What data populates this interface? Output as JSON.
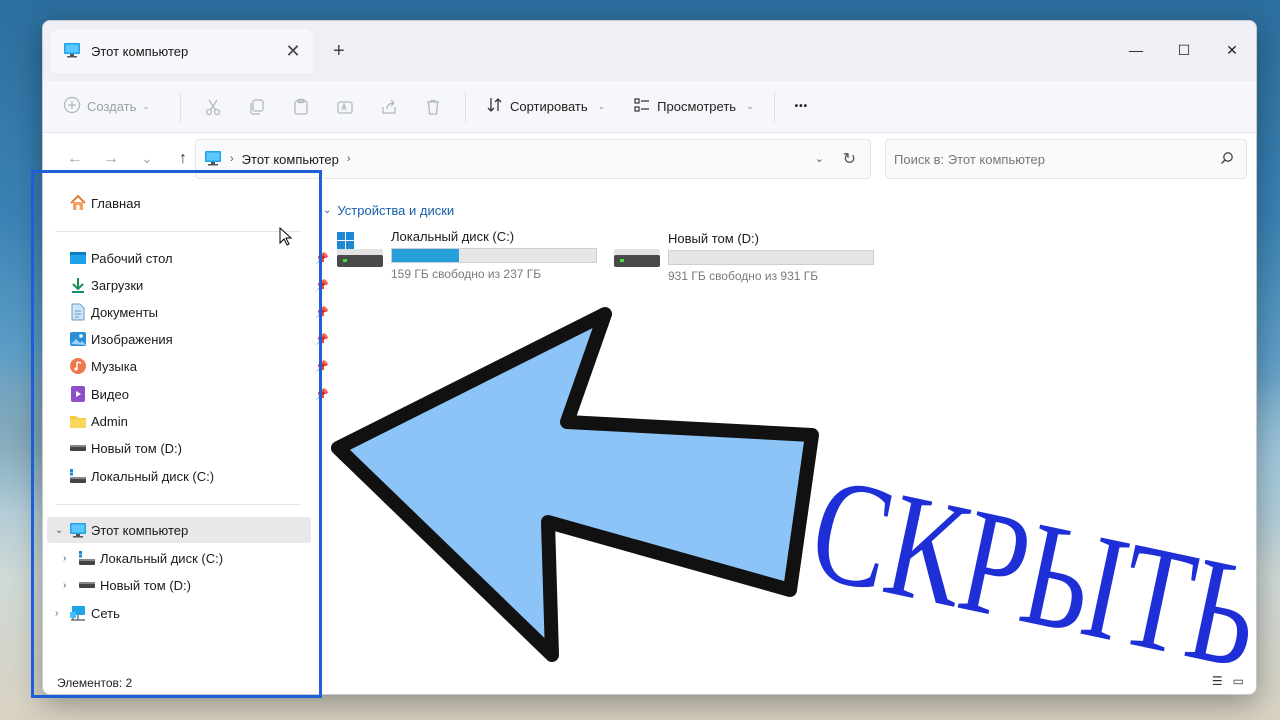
{
  "window": {
    "tab_title": "Этот компьютер",
    "tab_close": "✕",
    "new_tab": "+",
    "controls": {
      "minimize": "—",
      "maximize": "☐",
      "close": "✕"
    }
  },
  "toolbar": {
    "create_label": "Создать",
    "sort_label": "Сортировать",
    "view_label": "Просмотреть",
    "more_label": "•••"
  },
  "nav": {
    "back": "←",
    "forward": "→",
    "recent": "⌄",
    "up": "↑"
  },
  "address": {
    "crumb": "Этот компьютер"
  },
  "search": {
    "placeholder": "Поиск в: Этот компьютер"
  },
  "sidebar": {
    "home": "Главная",
    "quick": [
      {
        "label": "Рабочий стол",
        "icon": "desktop-icon",
        "pinned": true
      },
      {
        "label": "Загрузки",
        "icon": "download-icon",
        "pinned": true
      },
      {
        "label": "Документы",
        "icon": "document-icon",
        "pinned": true
      },
      {
        "label": "Изображения",
        "icon": "pictures-icon",
        "pinned": true
      },
      {
        "label": "Музыка",
        "icon": "music-icon",
        "pinned": true
      },
      {
        "label": "Видео",
        "icon": "video-icon",
        "pinned": true
      },
      {
        "label": "Admin",
        "icon": "folder-icon",
        "pinned": false
      },
      {
        "label": "Новый том (D:)",
        "icon": "drive-icon",
        "pinned": false
      },
      {
        "label": "Локальный диск (C:)",
        "icon": "system-drive-icon",
        "pinned": false
      }
    ],
    "this_pc": "Этот компьютер",
    "this_pc_children": [
      "Локальный диск (C:)",
      "Новый том (D:)"
    ],
    "network": "Сеть"
  },
  "content": {
    "group_title": "Устройства и диски",
    "drives": [
      {
        "name": "Локальный диск (C:)",
        "free_text": "159 ГБ свободно из 237 ГБ",
        "used_fraction": 0.33
      },
      {
        "name": "Новый том (D:)",
        "free_text": "931 ГБ свободно из 931 ГБ",
        "used_fraction": 0.0
      }
    ]
  },
  "status": {
    "items": "Элементов: 2"
  },
  "overlay": {
    "text": "СКРЫТЬ",
    "arrow_color": "#8cc4f8",
    "text_color": "#1f2fd8",
    "highlight_color": "#1e5fd8"
  },
  "colors": {
    "accent": "#26a0da",
    "link": "#1a5fa6"
  }
}
